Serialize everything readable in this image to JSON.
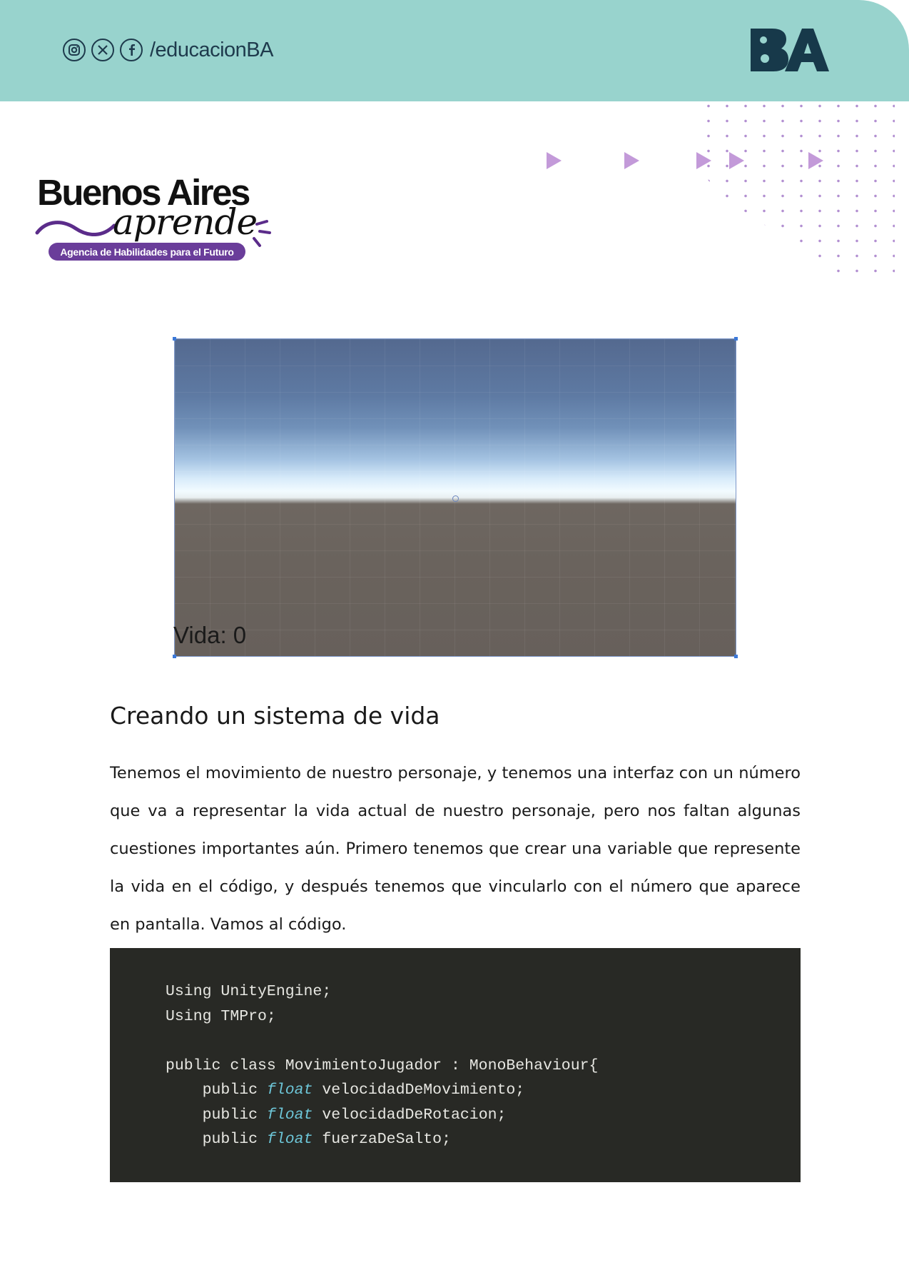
{
  "header": {
    "social_icons": [
      "instagram-icon",
      "x-icon",
      "facebook-icon"
    ],
    "handle": "/educacionBA",
    "ba_logo": "BA",
    "band_color": "#98d3cd"
  },
  "brand": {
    "title": "Buenos Aires",
    "script": "aprende",
    "tagline": "Agencia de Habilidades para el Futuro",
    "pill_color": "#6a3d9a"
  },
  "game_view": {
    "hud_text": "Vida: 0"
  },
  "section": {
    "heading": "Creando un sistema de vida",
    "paragraph": "Tenemos el movimiento de nuestro personaje, y tenemos una interfaz con un número que va a representar la vida actual de nuestro personaje, pero nos faltan algunas cuestiones importantes aún. Primero tenemos que crear una variable que represente la vida en el código, y después tenemos que vincularlo con el número que aparece en pantalla. Vamos al código."
  },
  "code": {
    "line1": "Using UnityEngine;",
    "line2": "Using TMPro;",
    "line4": "public class MovimientoJugador : MonoBehaviour{",
    "l5_a": "public",
    "l5_kw": "float",
    "l5_b": "velocidadDeMovimiento;",
    "l6_a": "public",
    "l6_kw": "float",
    "l6_b": "velocidadDeRotacion;",
    "l7_a": "public",
    "l7_kw": "float",
    "l7_b": "fuerzaDeSalto;",
    "keyword_color": "#6dc6d8",
    "background": "#282925"
  }
}
